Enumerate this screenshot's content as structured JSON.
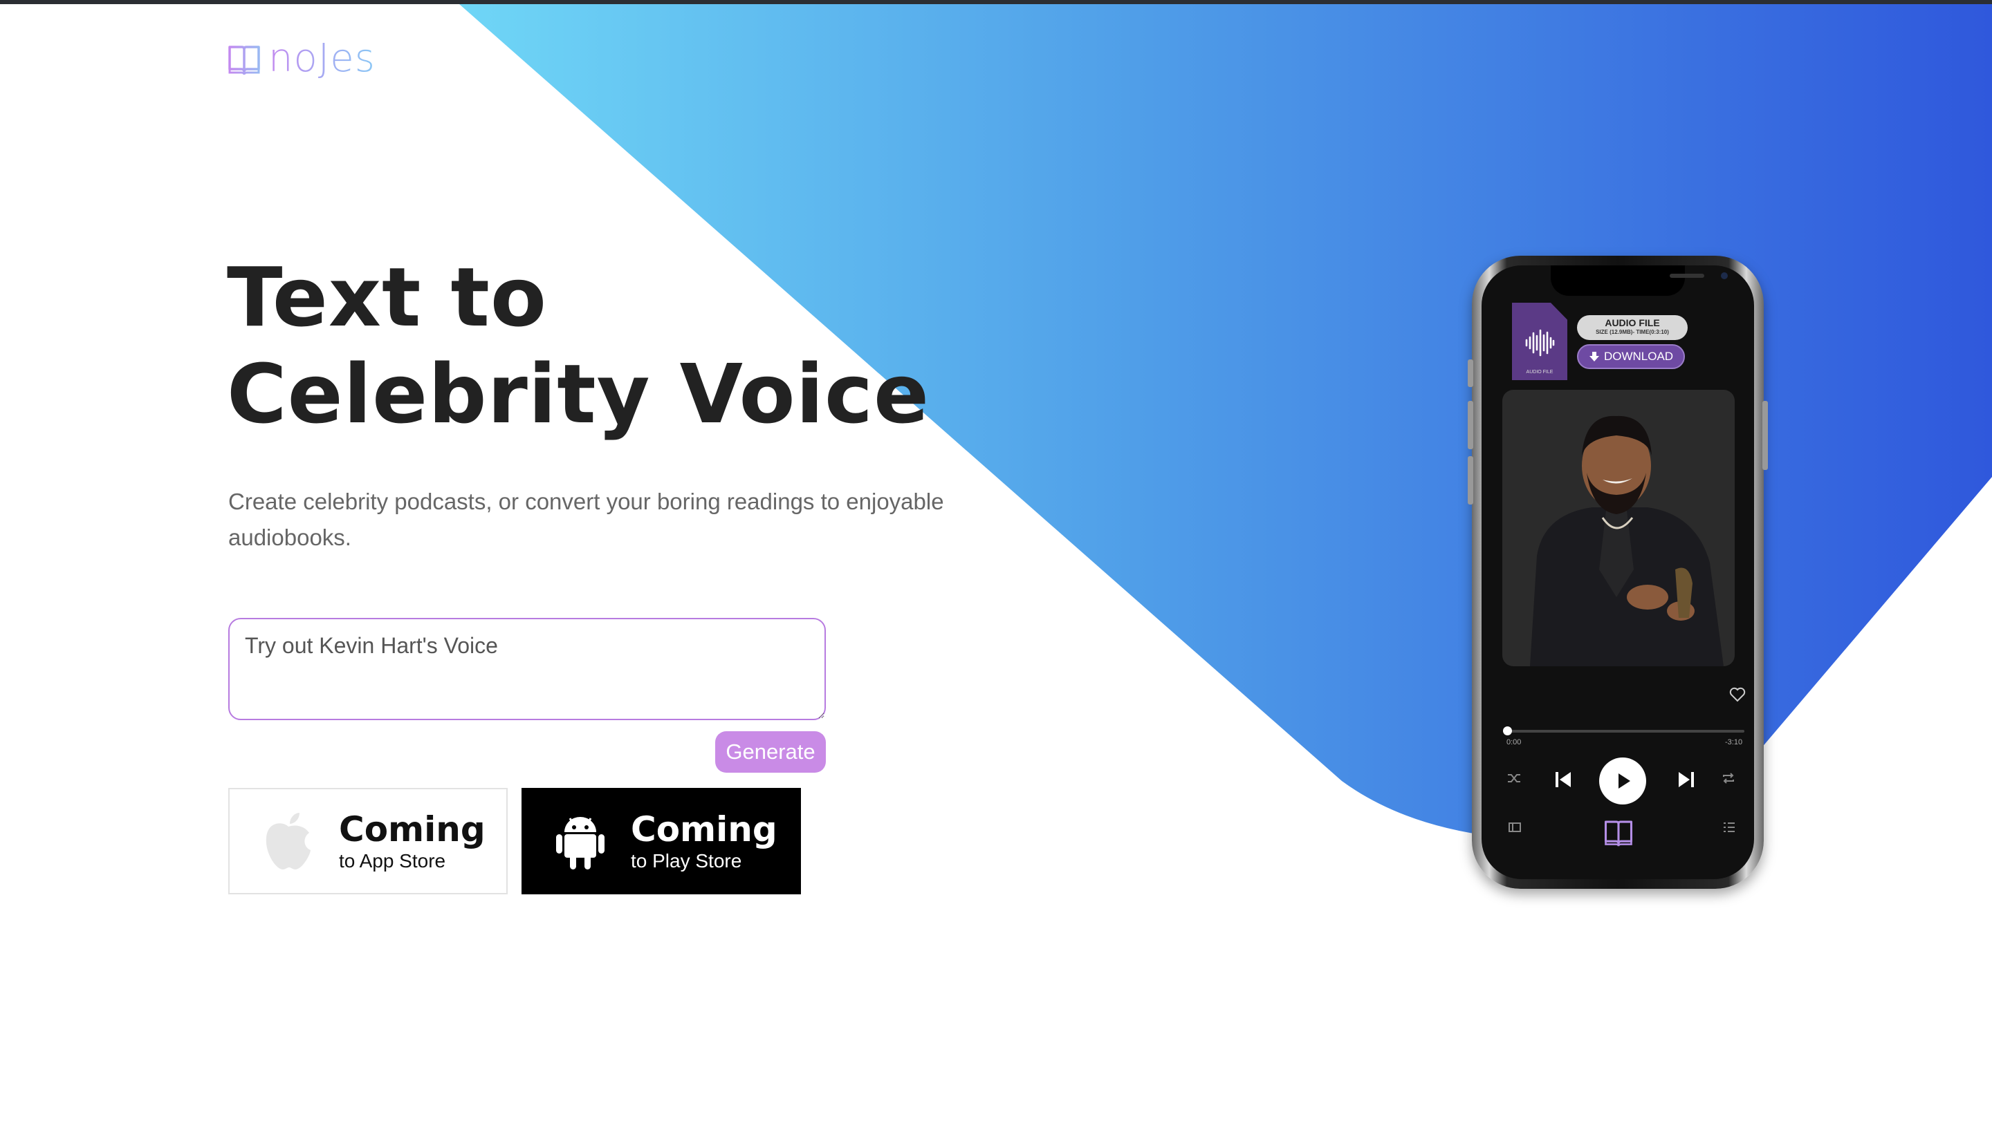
{
  "brand": {
    "name": "noJes"
  },
  "colors": {
    "accent_purple": "#c98be6",
    "gradient_start": "#6fd6f6",
    "gradient_end": "#2f58dc",
    "input_border": "#b77be0"
  },
  "hero": {
    "title_line1": "Text to",
    "title_line2": "Celebrity Voice",
    "subtitle": "Create celebrity podcasts, or convert your boring readings to enjoyable audiobooks."
  },
  "tts": {
    "placeholder": "Try out Kevin Hart's Voice",
    "value": "",
    "generate_label": "Generate"
  },
  "stores": {
    "apple": {
      "big": "Coming",
      "small": "to App Store",
      "icon": "apple-icon"
    },
    "play": {
      "big": "Coming",
      "small": "to Play Store",
      "icon": "android-icon"
    }
  },
  "phone": {
    "audio_title": "AUDIO FILE",
    "audio_meta": "SIZE (12.9MB)- TIME(0:3:10)",
    "file_caption": "AUDIO FILE",
    "download_label": "DOWNLOAD",
    "time_elapsed": "0:00",
    "time_remaining": "-3:10",
    "progress": 0,
    "icons": [
      "heart-icon",
      "shuffle-icon",
      "previous-icon",
      "play-icon",
      "next-icon",
      "repeat-icon",
      "library-icon",
      "book-icon",
      "queue-icon"
    ]
  }
}
